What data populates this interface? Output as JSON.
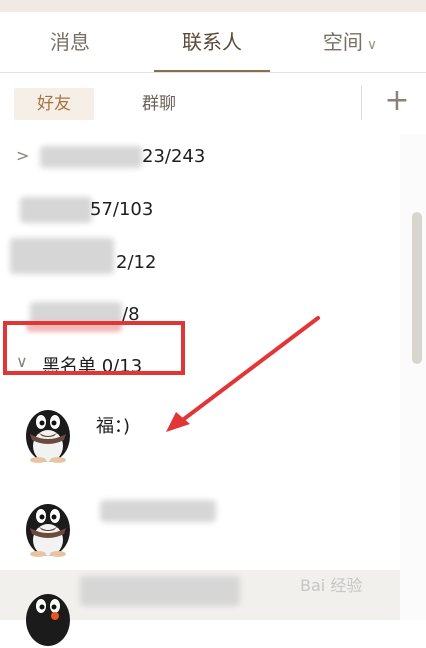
{
  "tabs": [
    {
      "label": "消息"
    },
    {
      "label": "联系人"
    },
    {
      "label": "空间"
    }
  ],
  "subtabs": [
    {
      "label": "好友"
    },
    {
      "label": "群聊"
    }
  ],
  "groups": [
    {
      "count": "23/243"
    },
    {
      "count": "57/103"
    },
    {
      "count": "2/12"
    },
    {
      "count": "/8"
    }
  ],
  "blacklist": {
    "label": "黑名单  0/13"
  },
  "contacts": [
    {
      "name": "福：)"
    },
    {
      "name": ""
    },
    {
      "name": ""
    }
  ],
  "watermark": "Bai 经验",
  "colors": {
    "accent": "#8b6e4e",
    "annotation_red": "#e23535",
    "badge_dot": "#e9531f"
  },
  "icons": {
    "add": "plus-icon",
    "expand": "chevron-right-icon",
    "collapse": "chevron-down-icon"
  }
}
